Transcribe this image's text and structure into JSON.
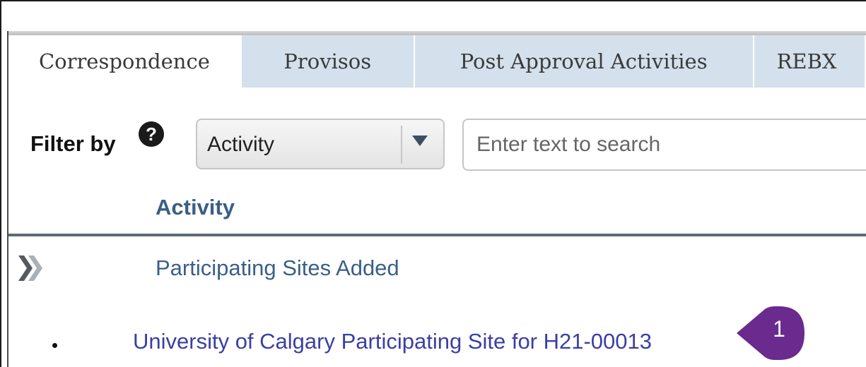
{
  "tabs": [
    {
      "label": "Correspondence",
      "active": true
    },
    {
      "label": "Provisos",
      "active": false
    },
    {
      "label": "Post Approval Activities",
      "active": false
    },
    {
      "label": "REBX",
      "active": false
    }
  ],
  "filter": {
    "label": "Filter by",
    "help_icon": "question-circle-icon",
    "help_glyph": "?",
    "selected": "Activity",
    "search_placeholder": "Enter text to search"
  },
  "table": {
    "column_header": "Activity",
    "rows": [
      {
        "icon": "expand-collapse-icon",
        "title": "Participating Sites Added",
        "items": [
          {
            "label": "University of Calgary Participating Site for H21-00013"
          }
        ]
      }
    ]
  },
  "callout": {
    "number": "1",
    "color": "#6a2a8e"
  },
  "colors": {
    "tab_inactive": "#d4e1ec",
    "header_text": "#3a5f86",
    "link_text": "#3b3fa3"
  }
}
